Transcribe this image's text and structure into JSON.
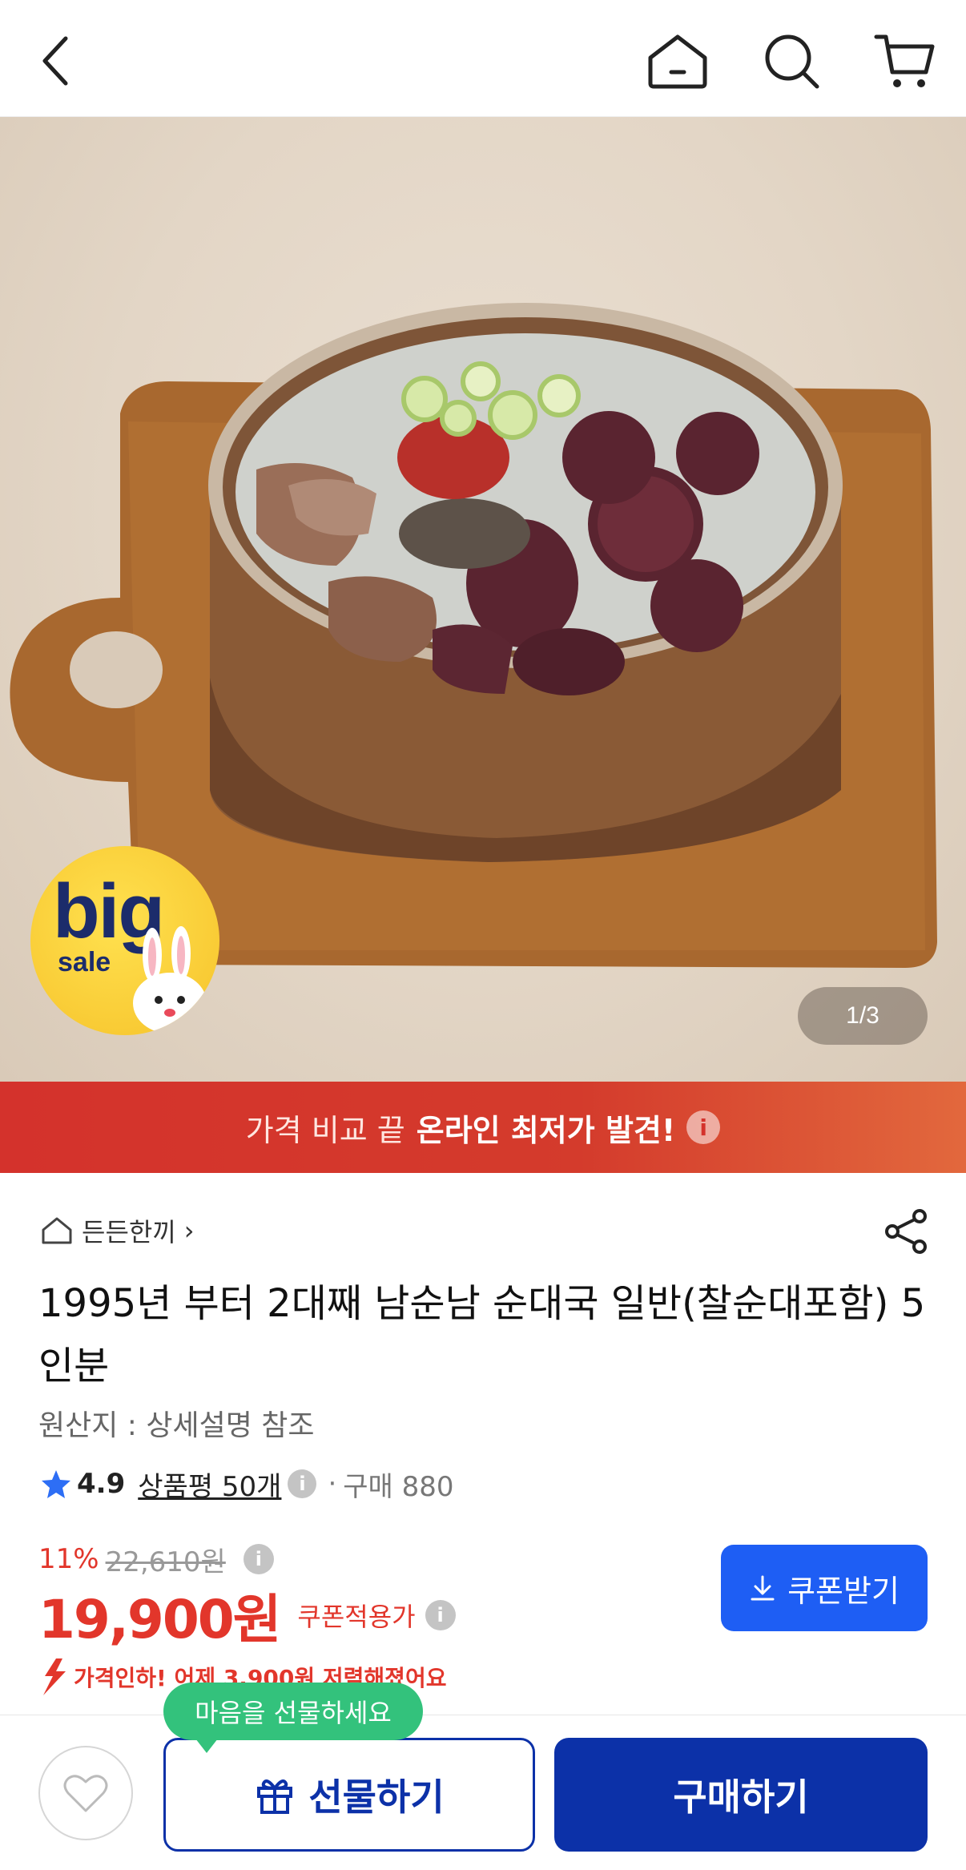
{
  "topbar": {
    "back_icon": "chevron-left-icon",
    "home_icon": "home-icon",
    "search_icon": "search-icon",
    "cart_icon": "cart-icon"
  },
  "hero": {
    "badge": {
      "big": "big",
      "sale": "sale"
    },
    "pager": "1/3"
  },
  "promo": {
    "light_text": "가격 비교 끝",
    "bold_text": "온라인 최저가 발견!",
    "info": "i",
    "colors": {
      "start": "#d4322c",
      "end": "#e2683d"
    }
  },
  "product": {
    "store": "든든한끼",
    "store_chevron": "›",
    "title": "1995년 부터 2대째 남순남 순대국 일반(찰순대포함) 5인분",
    "origin": "원산지 : 상세설명 참조",
    "rating": {
      "score": "4.9",
      "reviews": "상품평 50개",
      "info": "i",
      "separator": "·",
      "purchases": "구매 880"
    },
    "price": {
      "discount": "11%",
      "original": "22,610원",
      "info": "i",
      "final": "19,900원",
      "coupon_applied": "쿠폰적용가",
      "price_drop": "가격인하! 어제 3,900원 저렴해졌어요"
    },
    "coupon_button": "쿠폰받기"
  },
  "bottombar": {
    "tooltip": "마음을 선물하세요",
    "gift_button": "선물하기",
    "buy_button": "구매하기"
  },
  "colors": {
    "accent_red": "#e2362b",
    "coupon_blue": "#1e5ef4",
    "buy_navy": "#0c31a8",
    "tooltip_green": "#33c27c"
  }
}
